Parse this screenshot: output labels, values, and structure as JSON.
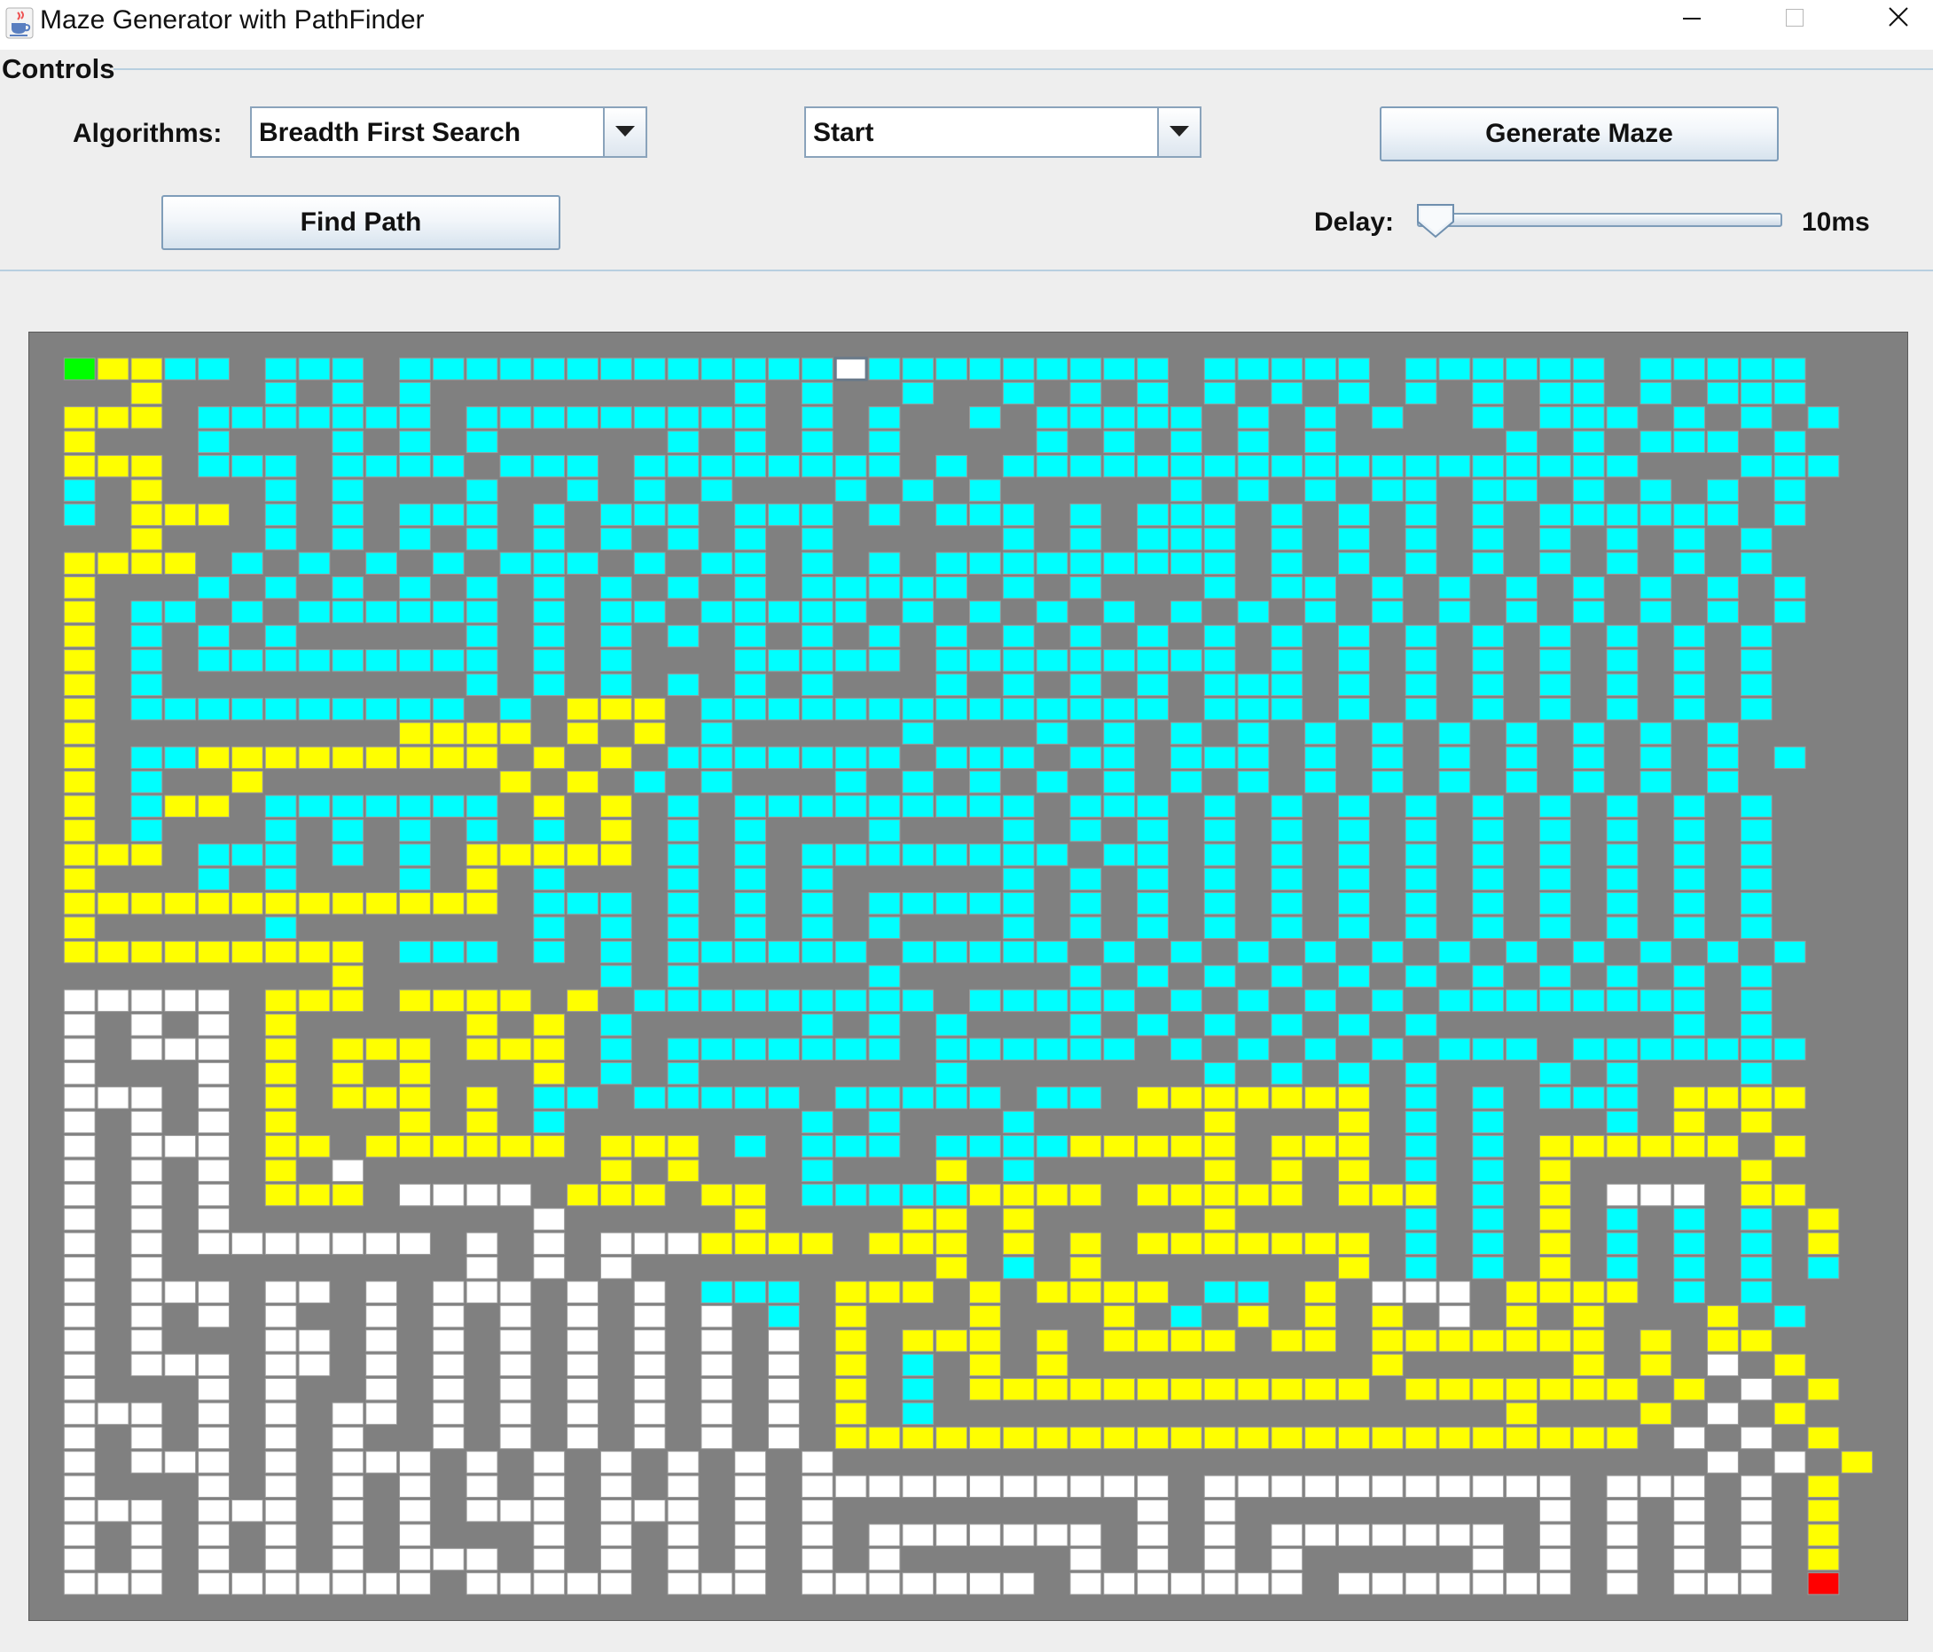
{
  "window": {
    "title": "Maze Generator with PathFinder",
    "icon": "java-cup-icon"
  },
  "controls": {
    "group_title": "Controls",
    "algorithms_label": "Algorithms:",
    "algorithm_selected": "Breadth First Search",
    "start_selected": "Start",
    "generate_button": "Generate Maze",
    "find_path_button": "Find Path",
    "delay_label": "Delay:",
    "delay_value": "10ms",
    "delay_level": 0.06
  },
  "colors": {
    "wall": "#808080",
    "open": "#ffffff",
    "visited": "#00ffff",
    "path": "#ffff00",
    "start": "#00ff00",
    "end": "#ff0000",
    "accent": "#7f9db9"
  },
  "maze": {
    "legend": {
      "#": "wall",
      ".": "open",
      "c": "visited",
      "y": "path",
      "S": "start",
      "E": "end",
      "o": "current"
    },
    "rows": [
      "#####################################################",
      "#Syycc#ccc#cccccccccccccoccccccccc#ccccc#cccccc#ccccc#",
      "###y###c#c#c#########c#c##c##c#c#c#c#c#c#c#c#cc#c#ccc#",
      "#yyy#ccccccc#ccccccccc#c#c##c#ccccc#c#c#c##c#ccc#c#c#c#",
      "#y###c###c#c#c#####c#c#c#c####c#c#c#c#c#####c#c#ccc#c#",
      "#yyy#ccc#cccc#ccc#cccccccc#c#ccccccccccccccccccc###ccc#",
      "#c#y###c#c###c##c#c#c###c#c#c#####c#c#c#cc#cc#c#c#c#c#",
      "#c#yyy#c#c#ccc#c#ccc#ccc#c#ccc#c#ccc#c#c#c#c#cccccc#c#",
      "###y###c#c#c#c#c#c#c#c#c#####c#c#ccc#c#c#c#c#c#c#c#c#",
      "#yyyy#c#c#c#c#ccc#c#cc#c#c#ccccccccc#c#c#c#c#c#c#c#c#",
      "#y###c#c#c#c#c#c#c#c#c#ccccc#c#c###c#cc#c#c#c#c#c#c#c#",
      "#y#cc#c#cccccc#c#cc#ccccc#c#c#c#c#c#c#c#c#c#c#c#c#c#c#",
      "#y#c#c#c#####c#c#c#c#c#c#c#c#c#c#c#c#c#c#c#c#c#c#c#c#",
      "#y#c#ccccccccc#c#c###ccccc#ccccccccc#c#c#c#c#c#c#c#c#",
      "#y#c#########c#c#c#c#c#c###c#c#c#c#ccc#c#c#c#c#c#c#c#",
      "#y#cccccccccc#c#yyy#cccccccccccccc#ccc#c#c#c#c#c#c#c#",
      "#y#########yyyy#y#y#c#####c###c#c#c#c#c#c#c#c#c#c#c#",
      "#y#ccyyyyyyyyy#y#y#ccccccc#ccc#cc#ccc#c#c#c#c#c#c#c#c#",
      "#y#c##y#######y#y#c#c###c#c#c#c#c#c#c#c#c#c#c#c#c#c#",
      "#y#cyy#ccccccc#y#y#c#ccccccccc#ccc#c#c#c#c#c#c#c#c#c#",
      "#y#c###c#c#c#c#c#y#c#c###c###c#c#c#c#c#c#c#c#c#c#c#c#",
      "#yyy#ccc#c#c#yyyyy#c#c#cccccccc#cc#c#c#c#c#c#c#c#c#c#",
      "#y###c#c###c#y#c###c#c#c#####c#c#c#c#c#c#c#c#c#c#c#c#",
      "#yyyyyyyyyyyyy#ccc#c#c#c#ccccc#c#c#c#c#c#c#c#c#c#c#c#",
      "#y#####c#######c#c#c#c#c#c###c#c#c#c#c#c#c#c#c#c#c#c#",
      "#yyyyyyyyy#ccc#c#c#cccccc#ccccc#c#c#c#c#c#c#c#c#c#c#c#",
      "#########y#######c#c#####c#####c#c#c#c#c#c#c#c#c#c#c#",
      "#.....#yyy#yyyy#y#ccccccccc#ccccc#c#c#c#c#cccccccc#c#",
      "#.#.#.#y#####y#y#c#####c#c#c###c#c#c#c#c#c#######c#c#",
      "#.#...#y#yyy#yyy#c#ccccccc#cccccc#c#c#c#c#ccc#ccccccc#",
      "#.###.#y#y#y###y#c#c#######c#######c#c#c#c###c#c###c#",
      "#...#.#y#yyy#y#cc#ccccc#ccccc#cc#yyyyyyy#c#c#ccc#yyyy#",
      "#.#.#.#y###y#y#c#######c#c###c#####y###y#c#c###c#y#y#",
      "#.#...#yy#yyyyyy#yyy#c#ccc#ccccyyyyy#yyy#c#c#yyyyyy#y#",
      "#.#.#.#y#.#######y#y###c###y#c#####y#y#y#c#c#y#####y#",
      "#.#.#.#yyy#....#yyy#yy#cccccyyyy#yyyyy#yyy#c#y#...#yy#",
      "#.#.#.#########.#####y####yy#y#####y#####c#c#y#c#c#c#y#",
      "#.#.#.......#.#.#...yyyy#yyy#y#y#yyyyyyy#c#c#y#c#c#c#y#",
      "#.#.#########.#.#.#########y#c#y#######y#c#c#y#c#c#c#c#",
      "#.#...#..#.#...#.#.#ccc#yyy#y#yyyy#cc#y#...#yyyy#c#c#",
      "#.#.#.#.##.#.#.#.#.#.#c#y###y###y#c#y#y#y#.#y#y###y#c#",
      "#.#.###..#.#.#.#.#.#.#.#y#yyy#y#yyyy#yy#yyyyyyy#y#yy#",
      "#.#...#..#.#.#.#.#.#.#.#y#c#y#y#########y#####y#y#.#y#",
      "#.###.#.##.#.#.#.#.#.#.#y#c#yyyyyyyyyyyy#yyyyyyy#y#.#y#",
      "#...#.#.#..#.#.#.#.#.#.#y#c#################y###y#.#y#",
      "#.#.#.#.#.##.#.#.#.#.#.#yyyyyyyyyyyyyyyyyyyyyyyy#.#.#y#",
      "#.#...#.#...#.#.#.#.#.#.##########################.#.#y#",
      "#.###.#.#.#.#.#.#.#.#.#...........#...........#...#.#y#",
      "#...#...#.#.#...#...#.#.#########.#.#########.#.#.#.#y#",
      "#.#.#.#.#.#.###.#.#.#.#.#.......#.#.#.......#.#.#.#.#y#",
      "#.#.#.#.#.#...#.#.#.#.#.#.#####.#.#.#.#####.#.#.#.#.#y#",
      "#...#.......#.....#...#.......#.......#.......#.#...#E#",
      "#####################################################"
    ]
  }
}
